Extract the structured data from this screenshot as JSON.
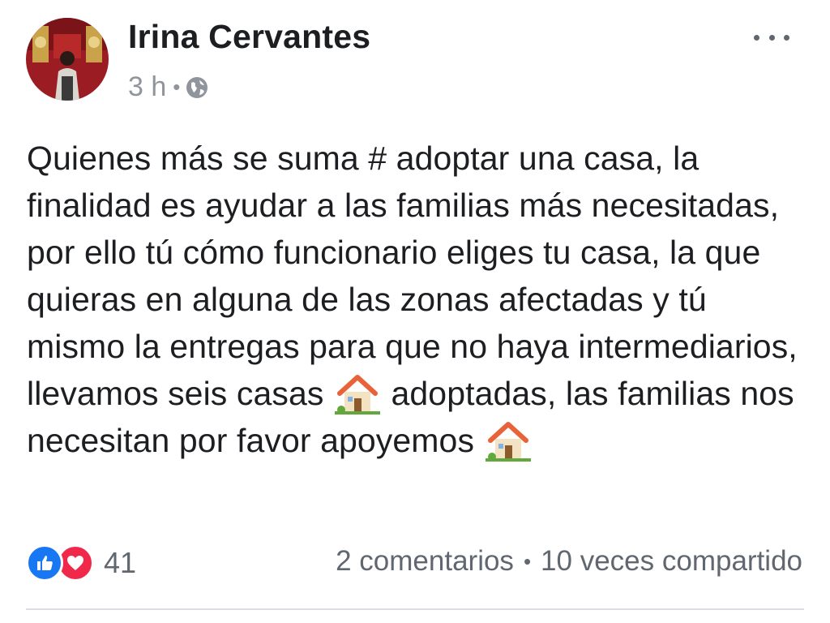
{
  "post": {
    "author": "Irina Cervantes",
    "time": "3 h",
    "separator": "•",
    "audience_icon": "globe-icon",
    "more_icon": "more-options-icon",
    "text_parts": [
      "Quienes más se suma # adoptar una casa, la finalidad es ayudar a las familias más necesitadas, por ello tú cómo funcionario eliges tu casa, la que quieras en alguna de las zonas afectadas y tú mismo la entregas para que no haya intermediarios, llevamos seis casas",
      "adoptadas, las familias nos necesitan por favor apoyemos"
    ],
    "emoji": "house-with-garden-emoji"
  },
  "footer": {
    "reaction_icons": [
      "like-icon",
      "love-icon"
    ],
    "reaction_count": "41",
    "comments": "2 comentarios",
    "separator": "•",
    "shares": "10 veces compartido"
  },
  "colors": {
    "text": "#1c1e21",
    "meta": "#90949c",
    "like": "#1877f2",
    "love": "#f0284a",
    "divider": "#dadde1"
  }
}
